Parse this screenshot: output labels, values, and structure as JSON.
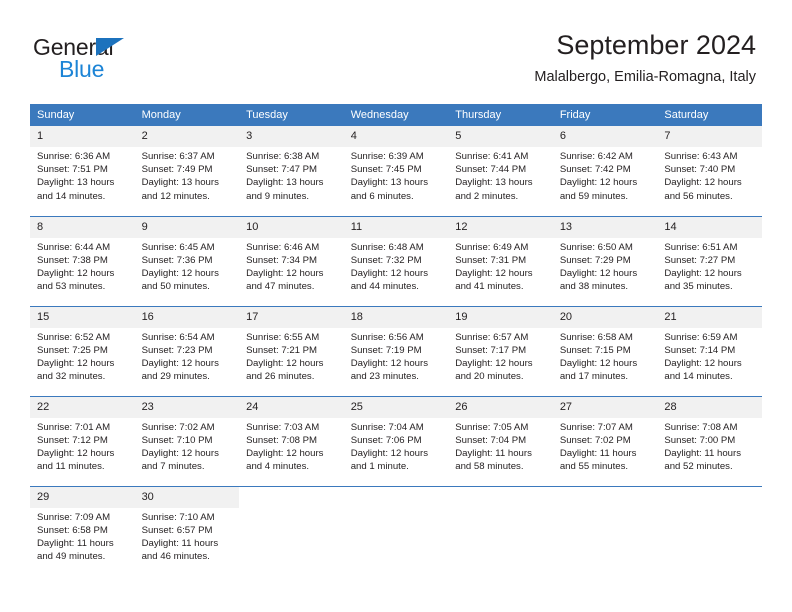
{
  "brand": {
    "name_top": "General",
    "name_bottom": "Blue",
    "accent_color": "#1c84d6",
    "triangle_color": "#1c72bd"
  },
  "header": {
    "title": "September 2024",
    "subtitle": "Malalbergo, Emilia-Romagna, Italy"
  },
  "theme": {
    "header_band": "#3b79bd",
    "daynum_background": "#f1f1f1",
    "text": "#231f20"
  },
  "labels": {
    "sunrise_prefix": "Sunrise:",
    "sunset_prefix": "Sunset:",
    "daylight_prefix": "Daylight:"
  },
  "weekdays": [
    "Sunday",
    "Monday",
    "Tuesday",
    "Wednesday",
    "Thursday",
    "Friday",
    "Saturday"
  ],
  "weeks": [
    [
      {
        "day": "1",
        "sunrise": "Sunrise: 6:36 AM",
        "sunset": "Sunset: 7:51 PM",
        "daylight": "Daylight: 13 hours and 14 minutes."
      },
      {
        "day": "2",
        "sunrise": "Sunrise: 6:37 AM",
        "sunset": "Sunset: 7:49 PM",
        "daylight": "Daylight: 13 hours and 12 minutes."
      },
      {
        "day": "3",
        "sunrise": "Sunrise: 6:38 AM",
        "sunset": "Sunset: 7:47 PM",
        "daylight": "Daylight: 13 hours and 9 minutes."
      },
      {
        "day": "4",
        "sunrise": "Sunrise: 6:39 AM",
        "sunset": "Sunset: 7:45 PM",
        "daylight": "Daylight: 13 hours and 6 minutes."
      },
      {
        "day": "5",
        "sunrise": "Sunrise: 6:41 AM",
        "sunset": "Sunset: 7:44 PM",
        "daylight": "Daylight: 13 hours and 2 minutes."
      },
      {
        "day": "6",
        "sunrise": "Sunrise: 6:42 AM",
        "sunset": "Sunset: 7:42 PM",
        "daylight": "Daylight: 12 hours and 59 minutes."
      },
      {
        "day": "7",
        "sunrise": "Sunrise: 6:43 AM",
        "sunset": "Sunset: 7:40 PM",
        "daylight": "Daylight: 12 hours and 56 minutes."
      }
    ],
    [
      {
        "day": "8",
        "sunrise": "Sunrise: 6:44 AM",
        "sunset": "Sunset: 7:38 PM",
        "daylight": "Daylight: 12 hours and 53 minutes."
      },
      {
        "day": "9",
        "sunrise": "Sunrise: 6:45 AM",
        "sunset": "Sunset: 7:36 PM",
        "daylight": "Daylight: 12 hours and 50 minutes."
      },
      {
        "day": "10",
        "sunrise": "Sunrise: 6:46 AM",
        "sunset": "Sunset: 7:34 PM",
        "daylight": "Daylight: 12 hours and 47 minutes."
      },
      {
        "day": "11",
        "sunrise": "Sunrise: 6:48 AM",
        "sunset": "Sunset: 7:32 PM",
        "daylight": "Daylight: 12 hours and 44 minutes."
      },
      {
        "day": "12",
        "sunrise": "Sunrise: 6:49 AM",
        "sunset": "Sunset: 7:31 PM",
        "daylight": "Daylight: 12 hours and 41 minutes."
      },
      {
        "day": "13",
        "sunrise": "Sunrise: 6:50 AM",
        "sunset": "Sunset: 7:29 PM",
        "daylight": "Daylight: 12 hours and 38 minutes."
      },
      {
        "day": "14",
        "sunrise": "Sunrise: 6:51 AM",
        "sunset": "Sunset: 7:27 PM",
        "daylight": "Daylight: 12 hours and 35 minutes."
      }
    ],
    [
      {
        "day": "15",
        "sunrise": "Sunrise: 6:52 AM",
        "sunset": "Sunset: 7:25 PM",
        "daylight": "Daylight: 12 hours and 32 minutes."
      },
      {
        "day": "16",
        "sunrise": "Sunrise: 6:54 AM",
        "sunset": "Sunset: 7:23 PM",
        "daylight": "Daylight: 12 hours and 29 minutes."
      },
      {
        "day": "17",
        "sunrise": "Sunrise: 6:55 AM",
        "sunset": "Sunset: 7:21 PM",
        "daylight": "Daylight: 12 hours and 26 minutes."
      },
      {
        "day": "18",
        "sunrise": "Sunrise: 6:56 AM",
        "sunset": "Sunset: 7:19 PM",
        "daylight": "Daylight: 12 hours and 23 minutes."
      },
      {
        "day": "19",
        "sunrise": "Sunrise: 6:57 AM",
        "sunset": "Sunset: 7:17 PM",
        "daylight": "Daylight: 12 hours and 20 minutes."
      },
      {
        "day": "20",
        "sunrise": "Sunrise: 6:58 AM",
        "sunset": "Sunset: 7:15 PM",
        "daylight": "Daylight: 12 hours and 17 minutes."
      },
      {
        "day": "21",
        "sunrise": "Sunrise: 6:59 AM",
        "sunset": "Sunset: 7:14 PM",
        "daylight": "Daylight: 12 hours and 14 minutes."
      }
    ],
    [
      {
        "day": "22",
        "sunrise": "Sunrise: 7:01 AM",
        "sunset": "Sunset: 7:12 PM",
        "daylight": "Daylight: 12 hours and 11 minutes."
      },
      {
        "day": "23",
        "sunrise": "Sunrise: 7:02 AM",
        "sunset": "Sunset: 7:10 PM",
        "daylight": "Daylight: 12 hours and 7 minutes."
      },
      {
        "day": "24",
        "sunrise": "Sunrise: 7:03 AM",
        "sunset": "Sunset: 7:08 PM",
        "daylight": "Daylight: 12 hours and 4 minutes."
      },
      {
        "day": "25",
        "sunrise": "Sunrise: 7:04 AM",
        "sunset": "Sunset: 7:06 PM",
        "daylight": "Daylight: 12 hours and 1 minute."
      },
      {
        "day": "26",
        "sunrise": "Sunrise: 7:05 AM",
        "sunset": "Sunset: 7:04 PM",
        "daylight": "Daylight: 11 hours and 58 minutes."
      },
      {
        "day": "27",
        "sunrise": "Sunrise: 7:07 AM",
        "sunset": "Sunset: 7:02 PM",
        "daylight": "Daylight: 11 hours and 55 minutes."
      },
      {
        "day": "28",
        "sunrise": "Sunrise: 7:08 AM",
        "sunset": "Sunset: 7:00 PM",
        "daylight": "Daylight: 11 hours and 52 minutes."
      }
    ],
    [
      {
        "day": "29",
        "sunrise": "Sunrise: 7:09 AM",
        "sunset": "Sunset: 6:58 PM",
        "daylight": "Daylight: 11 hours and 49 minutes."
      },
      {
        "day": "30",
        "sunrise": "Sunrise: 7:10 AM",
        "sunset": "Sunset: 6:57 PM",
        "daylight": "Daylight: 11 hours and 46 minutes."
      },
      {
        "day": "",
        "sunrise": "",
        "sunset": "",
        "daylight": ""
      },
      {
        "day": "",
        "sunrise": "",
        "sunset": "",
        "daylight": ""
      },
      {
        "day": "",
        "sunrise": "",
        "sunset": "",
        "daylight": ""
      },
      {
        "day": "",
        "sunrise": "",
        "sunset": "",
        "daylight": ""
      },
      {
        "day": "",
        "sunrise": "",
        "sunset": "",
        "daylight": ""
      }
    ]
  ]
}
